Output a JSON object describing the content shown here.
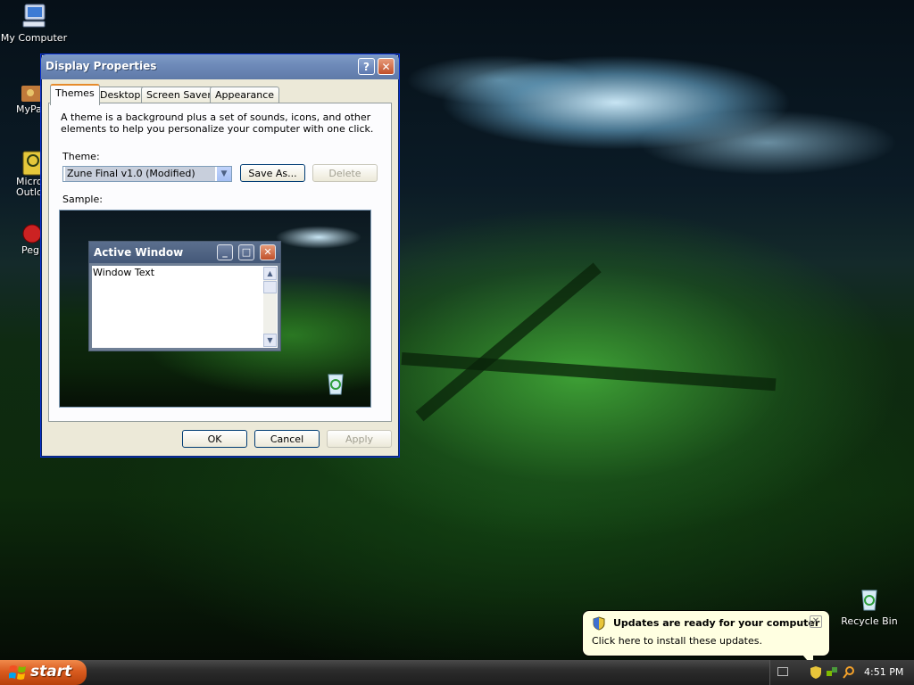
{
  "desktop": {
    "icons": [
      {
        "label": "My Computer"
      },
      {
        "label": "MyPa"
      },
      {
        "label": "Micros Outlo"
      },
      {
        "label": "Peg"
      },
      {
        "label": "Recycle Bin"
      }
    ]
  },
  "dialog": {
    "title": "Display Properties",
    "tabs": [
      "Themes",
      "Desktop",
      "Screen Saver",
      "Appearance"
    ],
    "description": "A theme is a background plus a set of sounds, icons, and other elements to help you personalize your computer with one click.",
    "theme_label": "Theme:",
    "theme_value": "Zune Final v1.0 (Modified)",
    "save_as": "Save As...",
    "delete": "Delete",
    "sample_label": "Sample:",
    "sample": {
      "window_title": "Active Window",
      "window_text": "Window Text"
    },
    "ok": "OK",
    "cancel": "Cancel",
    "apply": "Apply"
  },
  "taskbar": {
    "start_label": "start",
    "clock": "4:51 PM"
  },
  "balloon": {
    "title": "Updates are ready for your computer",
    "text": "Click here to install these updates."
  },
  "colors": {
    "titlebar_inactive": "#6d89b8",
    "start_button": "#d95b1f",
    "taskbar": "#2c2c2c",
    "balloon_bg": "#ffffe1"
  }
}
